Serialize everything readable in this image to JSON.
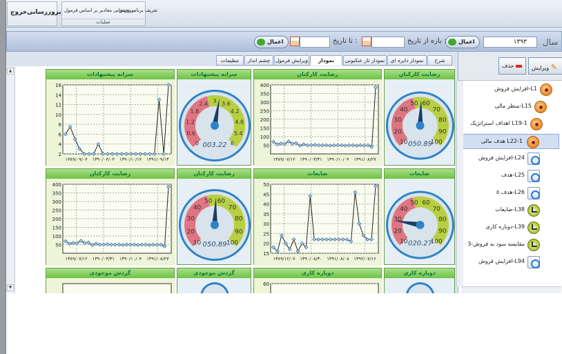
{
  "ribbon": {
    "buttons": [
      "خروج",
      "بروزرسانی",
      "بروزرسانی مقادیر بر اساس فرمول",
      "تعریف برنامه تحقق"
    ],
    "group_label": "عملیات"
  },
  "toolbar": {
    "year_label": "سال",
    "year_value": "۱۳۹۳",
    "period_label": "بازه از تاریخ :",
    "to_label": "تا تاریخ :",
    "apply_label": "اعمال"
  },
  "tabs": [
    "شرح",
    "نمودار دایره ای",
    "نمودار تار عنکبوتی",
    "نمودار شاخصها",
    "ویرایش فرمول",
    "چشم انداز",
    "تنظیمات"
  ],
  "active_tab": "نمودار شاخصها",
  "right_toolbar": {
    "edit_label": "ویرایش",
    "delete_label": "حذف"
  },
  "tree": [
    {
      "label": "افزایش فروش-L1",
      "icon": "target-icon"
    },
    {
      "label": "منظر مالی-L15",
      "icon": "target-icon"
    },
    {
      "label": "اهداف استراتژیک L19-1",
      "icon": "target-icon"
    },
    {
      "label": "هدف مالی L22-1",
      "icon": "target-icon",
      "selected": true
    },
    {
      "label": "افزایش فروش-L24",
      "icon": "clock-icon"
    },
    {
      "label": "هدف-L25",
      "icon": "clock-icon"
    },
    {
      "label": "هدف ٥-L26",
      "icon": "clock-icon"
    },
    {
      "label": "ضایعات-L38",
      "icon": "check-icon"
    },
    {
      "label": "دوباره کاری-L39",
      "icon": "check-icon"
    },
    {
      "label": "مقایسه سود به فروش-3",
      "icon": "check-icon"
    },
    {
      "label": "افزایش فروش-L94",
      "icon": "clock-icon"
    }
  ],
  "panels": {
    "gauges": [
      {
        "title": "رضایت کارکنان",
        "readout": "050.89",
        "value": 50.89,
        "ticks": [
          "10",
          "20",
          "30",
          "40",
          "50",
          "60",
          "70",
          "80",
          "90",
          "100"
        ]
      },
      {
        "title": "سرانه پیشنهادات",
        "readout": "003.22",
        "value": 3.22,
        "ticks": [
          "0",
          "0.6",
          "1.2",
          "1.8",
          "2.4",
          "3",
          "3.6",
          "4.2",
          "4.8",
          "5.4",
          "6"
        ]
      },
      {
        "title": "ضایعات",
        "readout": "020.27",
        "value": 20.27,
        "ticks": [
          "10",
          "20",
          "30",
          "40",
          "50",
          "60",
          "70",
          "80",
          "90",
          "100"
        ]
      },
      {
        "title": "رضایت کارکنان",
        "readout": "050.89",
        "value": 50.89,
        "ticks": [
          "10",
          "20",
          "30",
          "40",
          "50",
          "60",
          "70",
          "80",
          "90",
          "100"
        ]
      },
      {
        "title": "دوباره کاری",
        "readout": "",
        "value": 0,
        "ticks": []
      },
      {
        "title": "گردش موجودی",
        "readout": "",
        "value": 0,
        "ticks": []
      }
    ],
    "charts_titles": [
      "رضایت کارکنان",
      "سرانه پیشنهادات",
      "ضایعات",
      "رضایت کارکنان",
      "دوباره کاری",
      "گردش موجودی"
    ]
  },
  "chart_data": [
    {
      "type": "line",
      "title": "رضایت کارکنان",
      "ylim": [
        0,
        400
      ],
      "yticks": [
        50,
        100,
        150,
        200,
        250,
        300,
        350,
        400
      ],
      "xticks": [
        "۱۳۸۹/۰۷/۱۲",
        "۱۳۹۰/۰۳/۳۱",
        "۱۳۹۰/۱۰/۰۴",
        "۱۳۹۱/۰۸/۲۷"
      ],
      "values": [
        70,
        55,
        60,
        58,
        72,
        60,
        62,
        48,
        55,
        50,
        50,
        52,
        50,
        50,
        50,
        48,
        50,
        50,
        50,
        48,
        50,
        50,
        48,
        50,
        48,
        50,
        40,
        385
      ]
    },
    {
      "type": "line",
      "title": "سرانه پیشنهادات",
      "ylim": [
        2,
        16
      ],
      "yticks": [
        2,
        4,
        6,
        8,
        10,
        12,
        14,
        16
      ],
      "xticks": [
        "۱۳۸۹/۰۹/۰۴",
        "۱۳۹۰/۰۴/۰۴",
        "۱۳۹۰/۱۰/۱۴",
        "۱۳۹۱/۰۹/۱۳"
      ],
      "values": [
        6,
        7.5,
        5,
        3,
        2,
        2,
        2,
        4,
        2,
        2,
        2,
        2,
        2,
        2,
        2,
        2,
        2,
        2,
        2,
        2,
        13,
        2,
        16
      ]
    },
    {
      "type": "line",
      "title": "ضایعات",
      "ylim": [
        15,
        50
      ],
      "yticks": [
        15,
        20,
        25,
        30,
        35,
        40,
        45,
        50
      ],
      "xticks": [
        "۱۳۸۹/۱۲/۰۷",
        "۱۳۹۰/۰۸/۳۰",
        "۱۳۹۱/۰۸/۰۸",
        "۱۳۹۲/۰۷/۱۶"
      ],
      "values": [
        18,
        16,
        24,
        20,
        17,
        22,
        16,
        20,
        18,
        44,
        22,
        22,
        22,
        22,
        22,
        22,
        22,
        22,
        22,
        21,
        46,
        30,
        24,
        22,
        22,
        49
      ]
    },
    {
      "type": "line",
      "title": "رضایت کارکنان",
      "ylim": [
        0,
        400
      ],
      "yticks": [
        50,
        100,
        150,
        200,
        250,
        300,
        350,
        400
      ],
      "xticks": [
        "۱۳۸۹/۰۷/۱۲",
        "۱۳۹۰/۰۳/۳۱",
        "۱۳۹۰/۱۰/۰۴",
        "۱۳۹۱/۰۸/۲۷"
      ],
      "values": [
        70,
        55,
        60,
        58,
        72,
        60,
        62,
        48,
        55,
        50,
        50,
        52,
        50,
        50,
        50,
        48,
        50,
        50,
        50,
        48,
        50,
        50,
        48,
        50,
        48,
        50,
        40,
        385
      ]
    },
    {
      "type": "line",
      "title": "دوباره کاری",
      "ylim": [
        0,
        60
      ],
      "yticks": [
        60
      ],
      "xticks": [],
      "values": []
    },
    {
      "type": "line",
      "title": "گردش موجودی",
      "ylim": [
        0,
        0
      ],
      "yticks": [],
      "xticks": [],
      "values": []
    }
  ]
}
